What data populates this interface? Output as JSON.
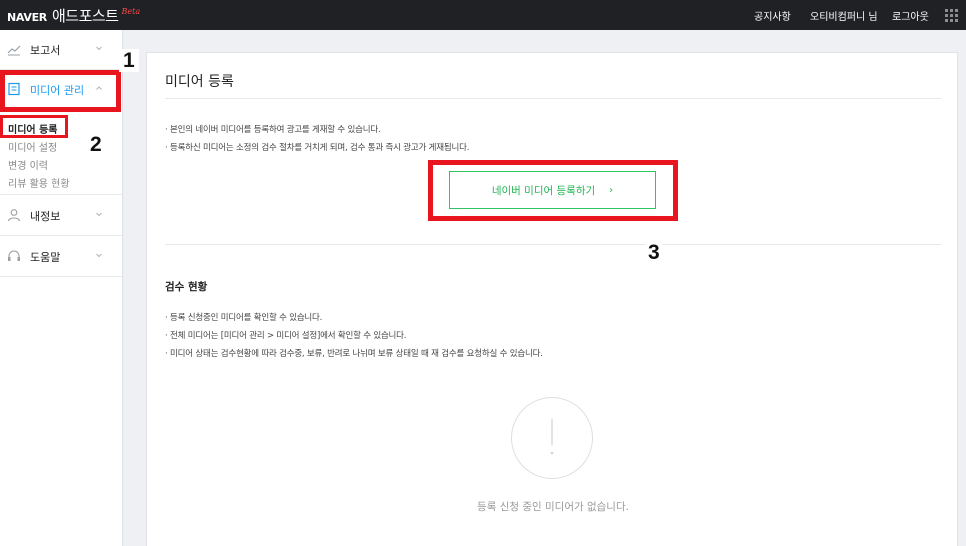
{
  "header": {
    "brand": "NAVER",
    "product": "애드포스트",
    "beta": "Beta",
    "nav": [
      "공지사항",
      "오티비컴퍼니 님",
      "로그아웃"
    ]
  },
  "sidebar": {
    "menus": [
      {
        "label": "보고서",
        "icon": "chart-line-icon"
      },
      {
        "label": "미디어 관리",
        "icon": "document-icon"
      },
      {
        "label": "내정보",
        "icon": "person-icon"
      },
      {
        "label": "도움말",
        "icon": "headset-icon"
      }
    ],
    "submenu": [
      "미디어 등록",
      "미디어 설정",
      "변경 이력",
      "리뷰 활용 현황"
    ]
  },
  "main": {
    "title": "미디어 등록",
    "descriptions": [
      "· 본인의 네이버 미디어를 등록하여 광고를 게재할 수 있습니다.",
      "· 등록하신 미디어는 소정의 검수 절차를 거치게 되며, 검수 통과 즉시 광고가 게재됩니다."
    ],
    "register_button": "네이버 미디어 등록하기",
    "register_arrow": "›",
    "review_title": "검수 현황",
    "review_descriptions": [
      "· 등록 신청중인 미디어를 확인할 수 있습니다.",
      "· 전체 미디어는 [미디어 관리 > 미디어 설정]에서 확인할 수 있습니다.",
      "· 미디어 상태는 검수현황에 따라 검수중, 보류, 반려로 나뉘며 보류 상태일 때 재 검수를 요청하실 수 있습니다."
    ],
    "empty_message": "등록 신청 중인 미디어가 없습니다."
  },
  "annotations": {
    "markers": [
      "1",
      "2",
      "3"
    ],
    "highlight_color": "#e8151f"
  },
  "colors": {
    "topbar": "#202124",
    "accent_green": "#1fb452",
    "active_menu": "#1a9bf0"
  }
}
